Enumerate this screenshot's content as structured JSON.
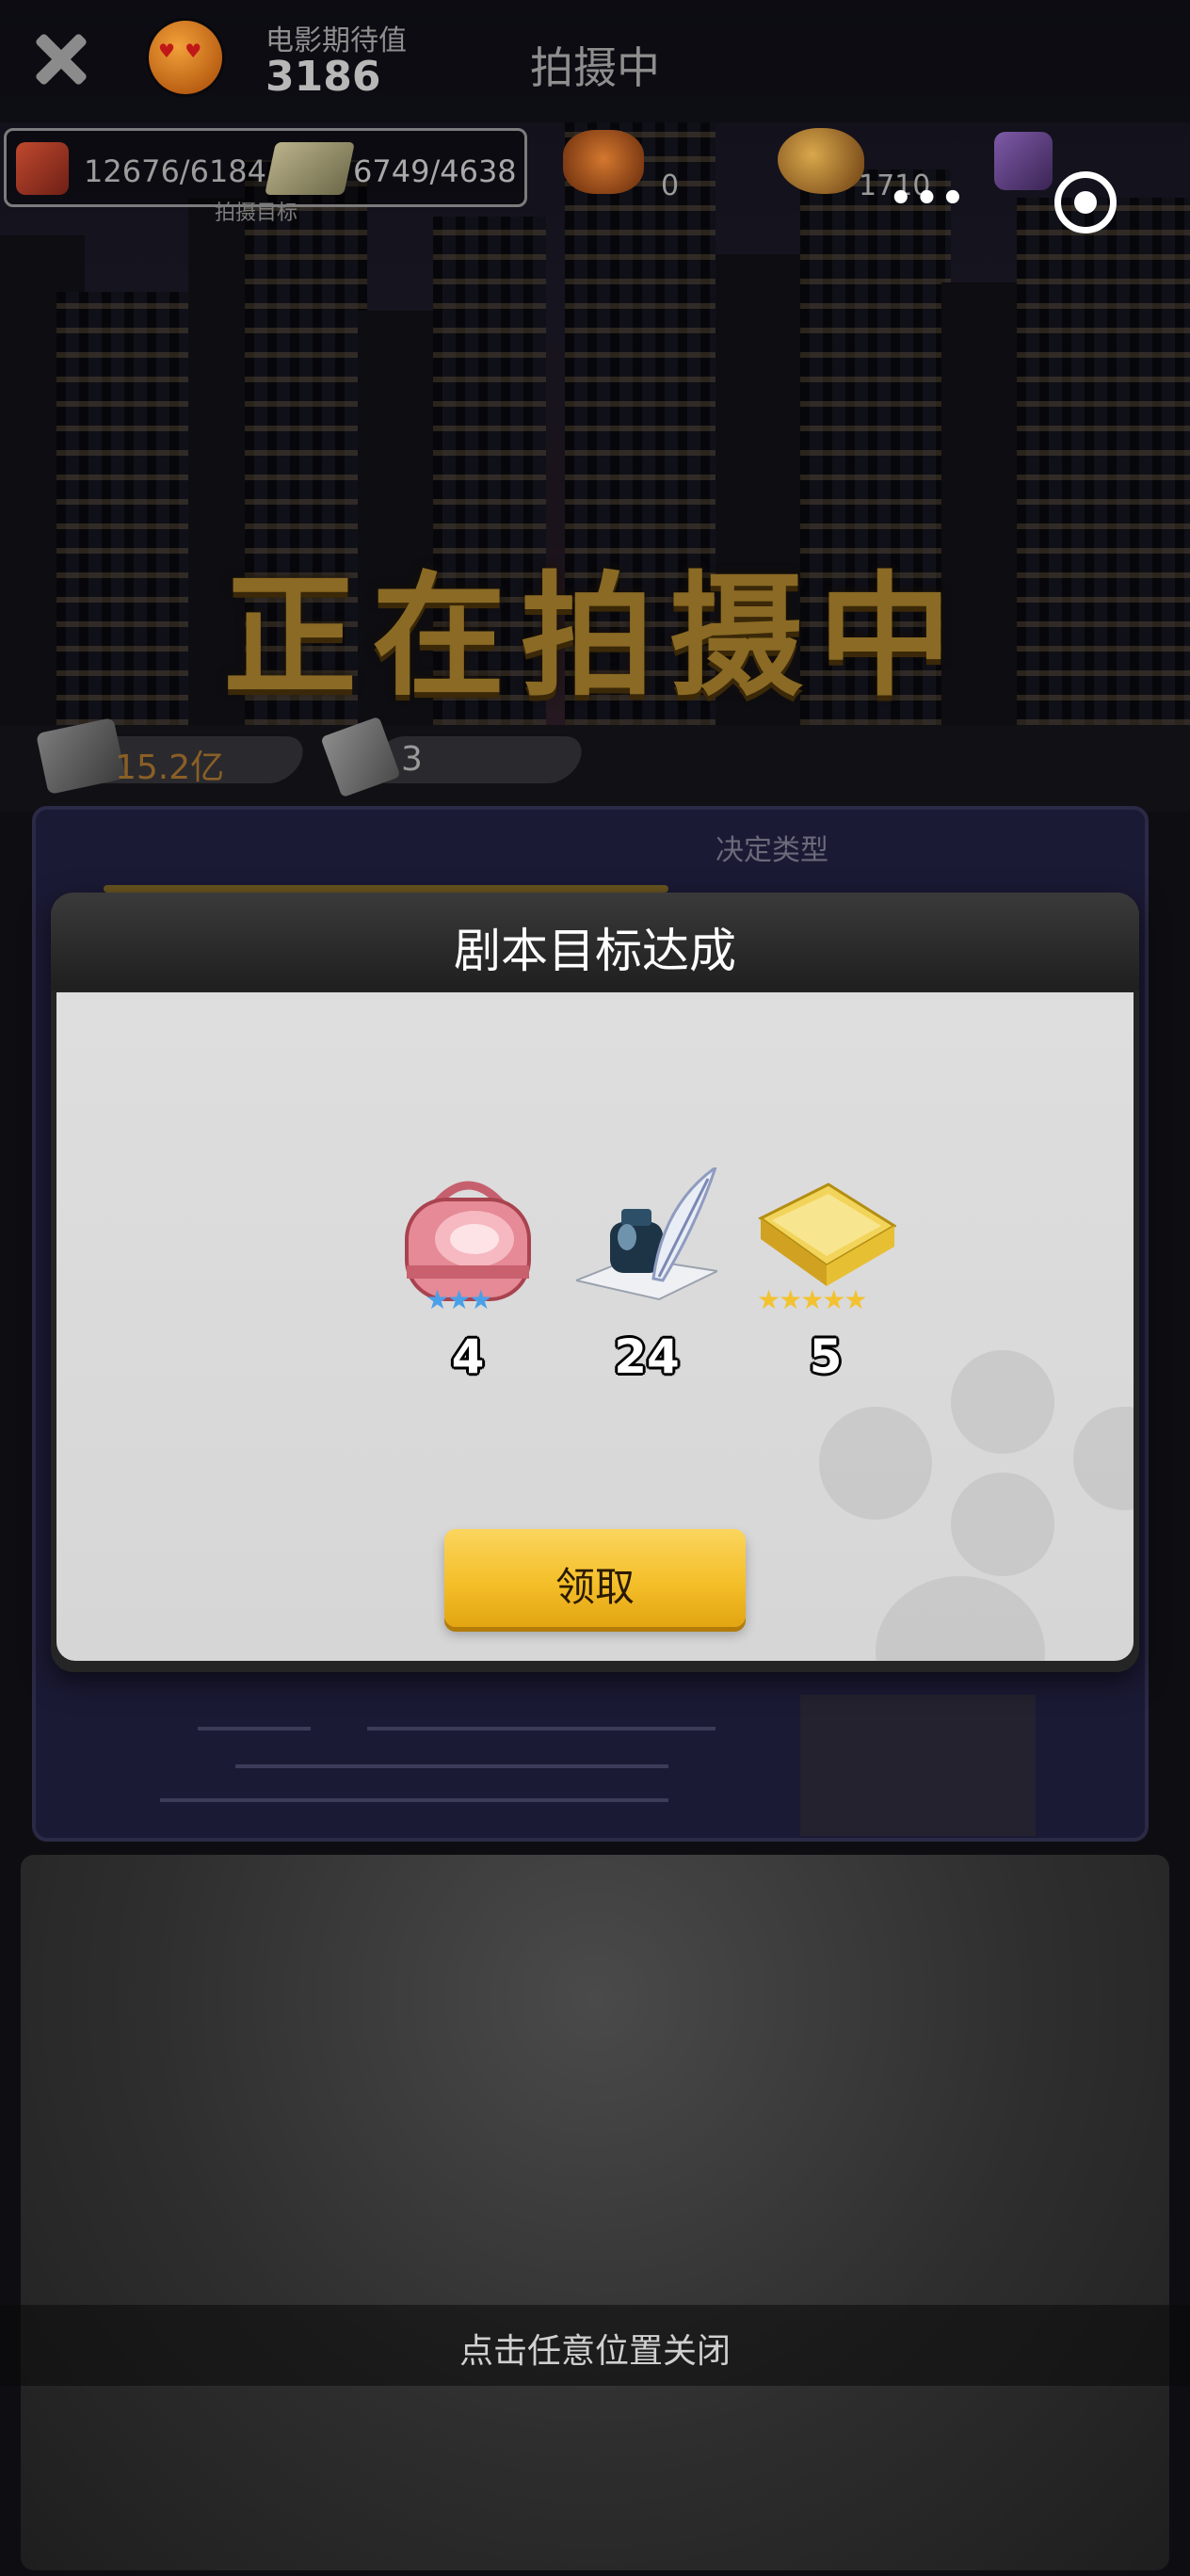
{
  "top_bar": {
    "expectation_label": "电影期待值",
    "expectation_value": "3186",
    "title": "拍摄中",
    "stat1": "12676/6184",
    "stat2": "6749/4638",
    "stats_caption": "拍摄目标",
    "resource1": "0",
    "resource2": "1710"
  },
  "banner": {
    "text": "正在拍摄中"
  },
  "currency": {
    "money": "15.2亿",
    "scripts": "3"
  },
  "panel": {
    "tab_label": "决定类型"
  },
  "modal": {
    "title": "剧本目标达成",
    "rewards": [
      {
        "icon": "pink-bag-icon",
        "count": "4",
        "stars": 3,
        "star_color": "#4aa0e8"
      },
      {
        "icon": "ink-quill-icon",
        "count": "24"
      },
      {
        "icon": "gold-book-icon",
        "count": "5",
        "stars": 5,
        "star_color": "#f2c230"
      }
    ],
    "claim_label": "领取"
  },
  "footer": {
    "close_hint": "点击任意位置关闭"
  }
}
